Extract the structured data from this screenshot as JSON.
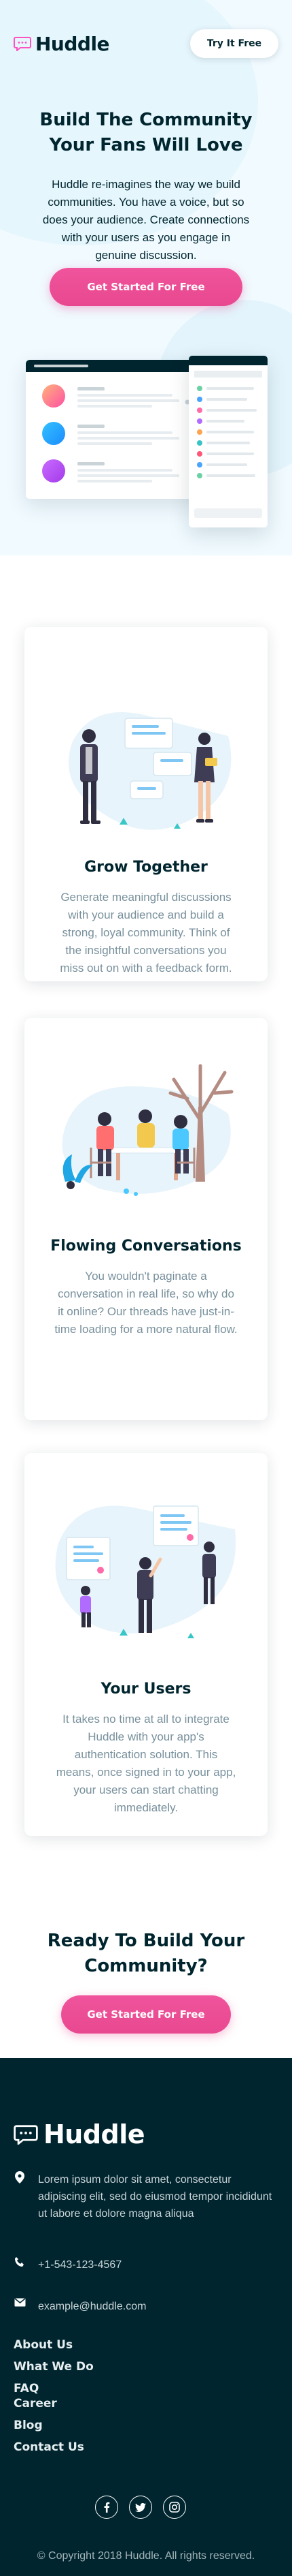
{
  "header": {
    "logo_text": "Huddle",
    "try_button": "Try It Free"
  },
  "hero": {
    "title_line1": "Build The Community",
    "title_line2": "Your Fans Will Love",
    "text": "Huddle re-imagines the way we build communities. You have a voice, but so does your audience. Create connections with your users as you engage in genuine discussion.",
    "cta_button": "Get Started For Free"
  },
  "features": [
    {
      "title": "Grow Together",
      "text": "Generate meaningful discussions with your audience and build a strong, loyal community. Think of the insightful conversations you miss out on with a feedback form."
    },
    {
      "title": "Flowing Conversations",
      "text": "You wouldn't paginate a conversation in real life, so why do it online? Our threads have just-in-time loading for a more natural flow."
    },
    {
      "title": "Your Users",
      "text": "It takes no time at all to integrate Huddle with your app's authentication solution. This means, once signed in to your app, your users can start chatting immediately."
    }
  ],
  "ready": {
    "title_line1": "Ready To Build Your",
    "title_line2": "Community?",
    "button": "Get Started For Free"
  },
  "footer": {
    "logo_text": "Huddle",
    "address": "Lorem ipsum dolor sit amet, consectetur adipiscing elit, sed do eiusmod tempor incididunt ut labore et dolore magna aliqua",
    "phone": "+1-543-123-4567",
    "email": "example@huddle.com",
    "links": [
      "About Us",
      "What We Do",
      "FAQ",
      "Career",
      "Blog",
      "Contact Us"
    ],
    "social_icons": [
      "facebook-icon",
      "twitter-icon",
      "instagram-icon"
    ],
    "copyright": "© Copyright 2018 Huddle. All rights reserved."
  },
  "colors": {
    "dark": "#00252e",
    "pink": "#ff52c1",
    "hero_bg": "#f0faff",
    "grey_text": "#78909c"
  }
}
